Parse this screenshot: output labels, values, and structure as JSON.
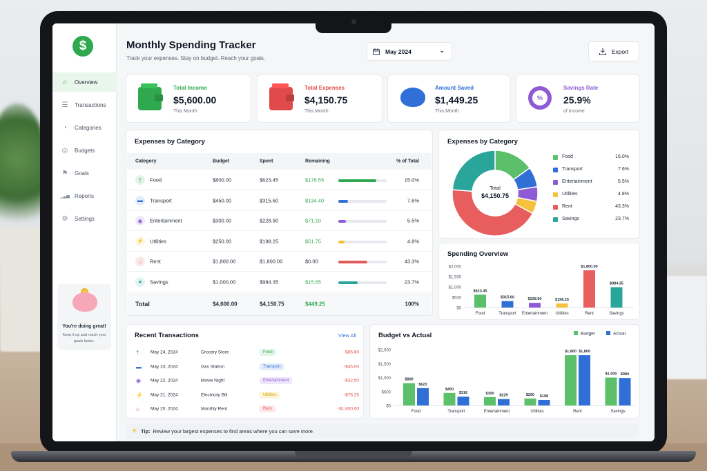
{
  "app": {
    "title": "Monthly Spending Tracker",
    "subtitle": "Track your expenses. Stay on budget. Reach your goals.",
    "month": "May 2024",
    "export_label": "Export"
  },
  "sidebar": {
    "logo": "$",
    "items": [
      {
        "label": "Overview",
        "icon": "home-icon",
        "active": true
      },
      {
        "label": "Transactions",
        "icon": "list-icon"
      },
      {
        "label": "Categories",
        "icon": "pie-icon"
      },
      {
        "label": "Budgets",
        "icon": "target-icon"
      },
      {
        "label": "Goals",
        "icon": "flag-icon"
      },
      {
        "label": "Reports",
        "icon": "bar-chart-icon"
      },
      {
        "label": "Settings",
        "icon": "gear-icon"
      }
    ],
    "promo": {
      "title": "You're doing great!",
      "text": "Keep it up and reach your goals faster."
    }
  },
  "stats": [
    {
      "label": "Total Income",
      "value": "$5,600.00",
      "sub": "This Month",
      "color": "#2fa84f",
      "icon": "wallet-icon"
    },
    {
      "label": "Total Expenses",
      "value": "$4,150.75",
      "sub": "This Month",
      "color": "#e04a4a",
      "icon": "wallet-icon"
    },
    {
      "label": "Amount Saved",
      "value": "$1,449.25",
      "sub": "This Month",
      "color": "#2f6fd6",
      "icon": "piggy-bank-icon"
    },
    {
      "label": "Savings Rate",
      "value": "25.9%",
      "sub": "of Income",
      "color": "#8e5ad6",
      "icon": "percent-icon"
    }
  ],
  "expenses_table": {
    "title": "Expenses by Category",
    "columns": [
      "Category",
      "Budget",
      "Spent",
      "Remaining",
      "% of Total"
    ],
    "rows": [
      {
        "category": "Food",
        "budget": "$800.00",
        "spent": "$623.45",
        "remaining": "$176.55",
        "pct": "15.0%",
        "fill": 0.78,
        "color": "#2fa84f",
        "icon": "fork-knife-icon"
      },
      {
        "category": "Transport",
        "budget": "$450.00",
        "spent": "$315.60",
        "remaining": "$134.40",
        "pct": "7.6%",
        "fill": 0.2,
        "color": "#2f6fd6",
        "icon": "car-icon"
      },
      {
        "category": "Entertainment",
        "budget": "$300.00",
        "spent": "$228.90",
        "remaining": "$71.10",
        "pct": "5.5%",
        "fill": 0.15,
        "color": "#8e5ad6",
        "icon": "gamepad-icon"
      },
      {
        "category": "Utilities",
        "budget": "$250.00",
        "spent": "$198.25",
        "remaining": "$51.75",
        "pct": "4.8%",
        "fill": 0.13,
        "color": "#f2c12e",
        "icon": "bolt-icon"
      },
      {
        "category": "Rent",
        "budget": "$1,800.00",
        "spent": "$1,800.00",
        "remaining": "$0.00",
        "pct": "43.3%",
        "fill": 0.6,
        "color": "#e05a5a",
        "icon": "house-icon"
      },
      {
        "category": "Savings",
        "budget": "$1,000.00",
        "spent": "$984.35",
        "remaining": "$15.65",
        "pct": "23.7%",
        "fill": 0.4,
        "color": "#2aa59a",
        "icon": "piggy-bank-icon"
      }
    ],
    "total": {
      "label": "Total",
      "budget": "$4,600.00",
      "spent": "$4,150.75",
      "remaining": "$449.25",
      "pct": "100%"
    }
  },
  "donut": {
    "title": "Expenses by Category",
    "center_label": "Total",
    "center_value": "$4,150.75"
  },
  "spending_overview": {
    "title": "Spending Overview"
  },
  "budget_vs_actual": {
    "title": "Budget vs Actual"
  },
  "transactions": {
    "title": "Recent Transactions",
    "view_all": "View All",
    "items": [
      {
        "date": "May 24, 2024",
        "desc": "Grocery Store",
        "cat": "Food",
        "amount": "-$85.60",
        "icon": "fork-knife-icon",
        "color": "#2fa84f",
        "bg": "#e3f5e8"
      },
      {
        "date": "May 23, 2024",
        "desc": "Gas Station",
        "cat": "Transport",
        "amount": "-$45.00",
        "icon": "car-icon",
        "color": "#2f6fd6",
        "bg": "#e2ecfb"
      },
      {
        "date": "May 22, 2024",
        "desc": "Movie Night",
        "cat": "Entertainment",
        "amount": "-$32.50",
        "icon": "gamepad-icon",
        "color": "#8e5ad6",
        "bg": "#efe6fb"
      },
      {
        "date": "May 21, 2024",
        "desc": "Electricity Bill",
        "cat": "Utilities",
        "amount": "-$76.25",
        "icon": "bolt-icon",
        "color": "#d9a400",
        "bg": "#fdf5d8"
      },
      {
        "date": "May 20, 2024",
        "desc": "Monthly Rent",
        "cat": "Rent",
        "amount": "-$1,800.00",
        "icon": "house-icon",
        "color": "#e05a5a",
        "bg": "#fde6e6"
      }
    ]
  },
  "tip": {
    "label": "Tip:",
    "text": "Review your largest expenses to find areas where you can save more."
  },
  "chart_data": [
    {
      "type": "pie",
      "title": "Expenses by Category",
      "categories": [
        "Food",
        "Transport",
        "Entertainment",
        "Utilities",
        "Rent",
        "Savings"
      ],
      "values": [
        15.0,
        7.6,
        5.5,
        4.8,
        43.3,
        23.7
      ],
      "labels": [
        "15.0%",
        "7.6%",
        "5.5%",
        "4.8%",
        "43.3%",
        "23.7%"
      ],
      "colors": [
        "#5cc06a",
        "#2f6fd6",
        "#8e5ad6",
        "#f6c23e",
        "#e85d5d",
        "#2aa59a"
      ],
      "legend": "right"
    },
    {
      "type": "bar",
      "title": "Spending Overview",
      "categories": [
        "Food",
        "Transport",
        "Entertainment",
        "Utilities",
        "Rent",
        "Savings"
      ],
      "values": [
        623.45,
        315.6,
        228.9,
        198.25,
        1800.0,
        984.35
      ],
      "data_labels": [
        "$623.45",
        "$315.60",
        "$228.90",
        "$198.25",
        "$1,800.00",
        "$984.35"
      ],
      "colors": [
        "#5cc06a",
        "#2f6fd6",
        "#8e5ad6",
        "#f6c23e",
        "#e85d5d",
        "#2aa59a"
      ],
      "yticks": [
        "$0",
        "$500",
        "$1,000",
        "$1,500",
        "$2,000"
      ],
      "ylim": [
        0,
        2000
      ]
    },
    {
      "type": "bar",
      "title": "Budget vs Actual",
      "categories": [
        "Food",
        "Transport",
        "Entertainment",
        "Utilities",
        "Rent",
        "Savings"
      ],
      "series": [
        {
          "name": "Budget",
          "values": [
            800,
            450,
            300,
            250,
            1800,
            1000
          ],
          "labels": [
            "$800",
            "$450",
            "$300",
            "$250",
            "$1,800",
            "$1,000"
          ],
          "color": "#5cc06a"
        },
        {
          "name": "Actual",
          "values": [
            623,
            316,
            229,
            198,
            1800,
            984
          ],
          "labels": [
            "$623",
            "$316",
            "$229",
            "$198",
            "$1,800",
            "$984"
          ],
          "color": "#2f6fd6"
        }
      ],
      "yticks": [
        "$0",
        "$500",
        "$1,000",
        "$1,500",
        "$2,000"
      ],
      "ylim": [
        0,
        2000
      ],
      "legend": "top-right"
    }
  ]
}
